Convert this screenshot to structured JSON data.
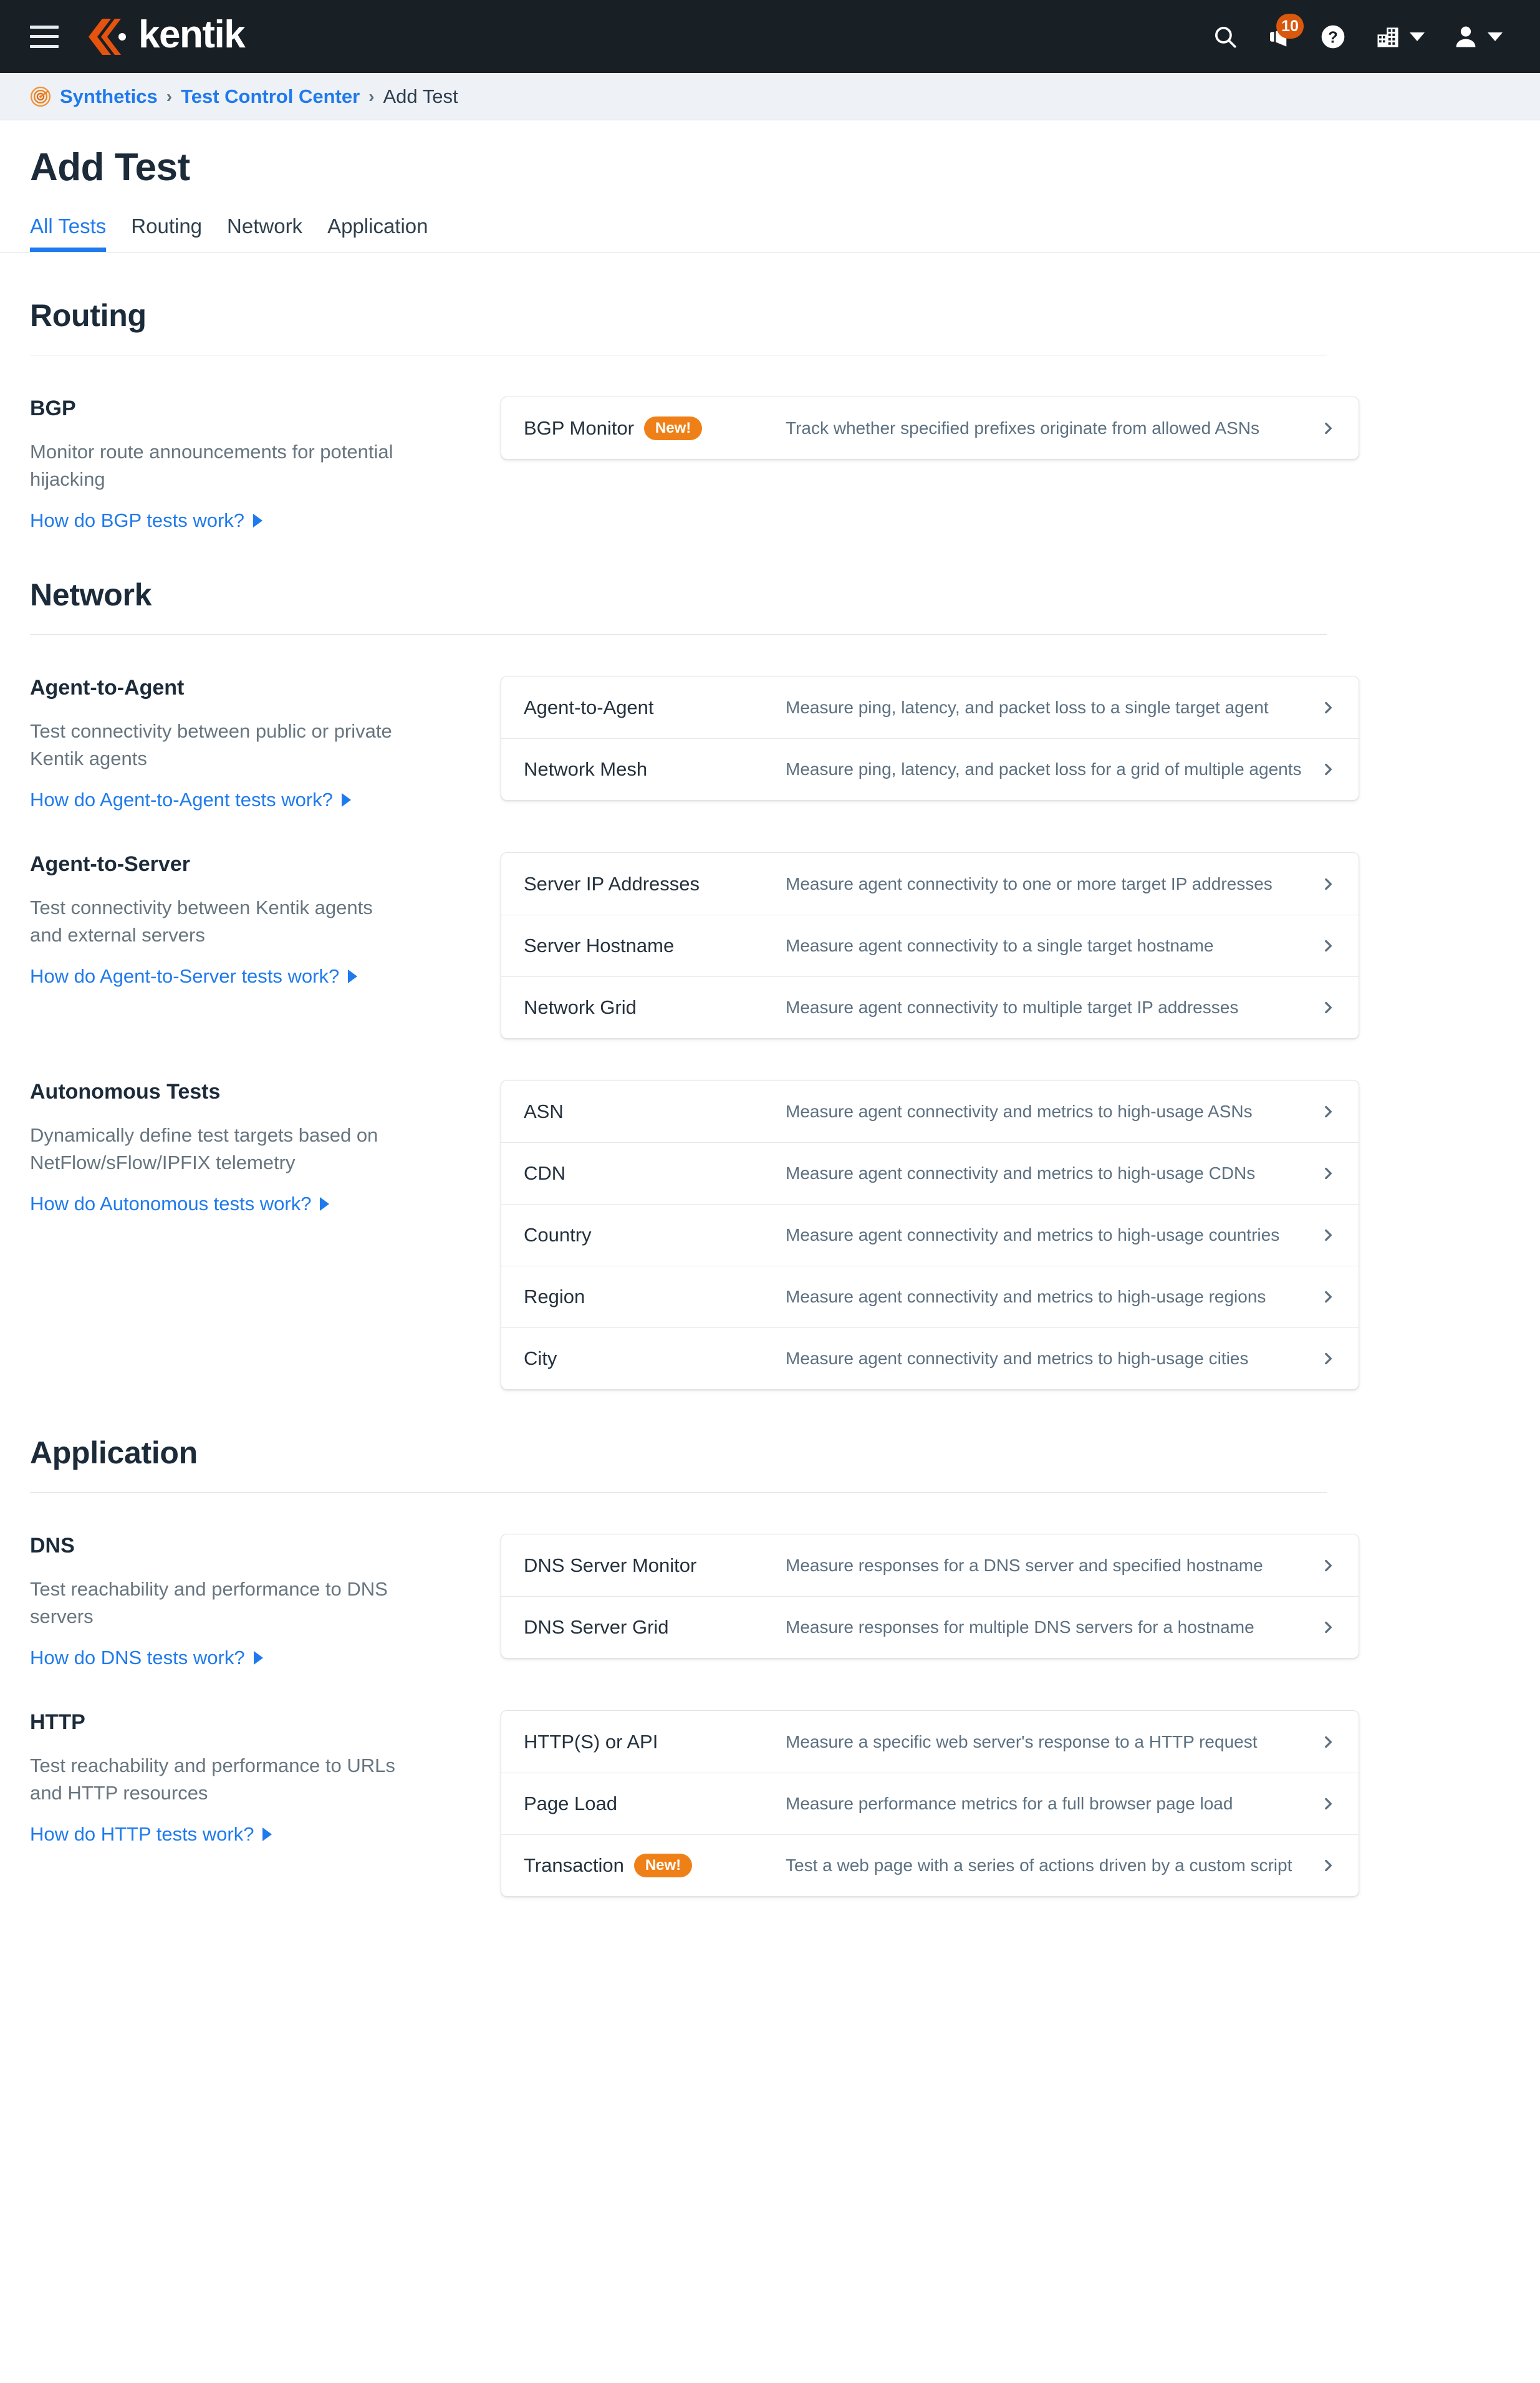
{
  "topnav": {
    "menu_icon": "hamburger-icon",
    "brand": "kentik",
    "search_icon": "search-icon",
    "announcements_icon": "announcement-icon",
    "announcements_badge": "10",
    "help_icon": "help-icon",
    "company_icon": "company-icon",
    "user_icon": "user-avatar-icon"
  },
  "breadcrumb": {
    "icon": "synthetics-radar-icon",
    "items": [
      "Synthetics",
      "Test Control Center"
    ],
    "separator": "›",
    "current": "Add Test"
  },
  "page": {
    "title": "Add Test",
    "tabs": [
      {
        "label": "All Tests",
        "active": true
      },
      {
        "label": "Routing",
        "active": false
      },
      {
        "label": "Network",
        "active": false
      },
      {
        "label": "Application",
        "active": false
      }
    ]
  },
  "colors": {
    "brand_orange": "#ef8018",
    "accent_blue": "#1f7aed",
    "nav_dark": "#182026",
    "badge_orange": "#d9580d"
  },
  "groups": [
    {
      "title": "Routing",
      "sections": [
        {
          "name": "BGP",
          "description": "Monitor route announcements for potential hijacking",
          "link": "How do BGP tests work?",
          "rows": [
            {
              "name": "BGP Monitor",
              "badge": "New!",
              "description": "Track whether specified prefixes originate from allowed ASNs"
            }
          ]
        }
      ]
    },
    {
      "title": "Network",
      "sections": [
        {
          "name": "Agent-to-Agent",
          "description": "Test connectivity between public or private Kentik agents",
          "link": "How do Agent-to-Agent tests work?",
          "rows": [
            {
              "name": "Agent-to-Agent",
              "badge": "",
              "description": "Measure ping, latency, and packet loss to a single target agent"
            },
            {
              "name": "Network Mesh",
              "badge": "",
              "description": "Measure ping, latency, and packet loss for a grid of multiple agents"
            }
          ]
        },
        {
          "name": "Agent-to-Server",
          "description": "Test connectivity between Kentik agents and external servers",
          "link": "How do Agent-to-Server tests work?",
          "rows": [
            {
              "name": "Server IP Addresses",
              "badge": "",
              "description": "Measure agent connectivity to one or more target IP addresses"
            },
            {
              "name": "Server Hostname",
              "badge": "",
              "description": "Measure agent connectivity to a single target hostname"
            },
            {
              "name": "Network Grid",
              "badge": "",
              "description": "Measure agent connectivity to multiple target IP addresses"
            }
          ]
        },
        {
          "name": "Autonomous Tests",
          "description": "Dynamically define test targets based on NetFlow/sFlow/IPFIX telemetry",
          "link": "How do Autonomous tests work?",
          "rows": [
            {
              "name": "ASN",
              "badge": "",
              "description": "Measure agent connectivity and metrics to high-usage ASNs"
            },
            {
              "name": "CDN",
              "badge": "",
              "description": "Measure agent connectivity and metrics to high-usage CDNs"
            },
            {
              "name": "Country",
              "badge": "",
              "description": "Measure agent connectivity and metrics to high-usage countries"
            },
            {
              "name": "Region",
              "badge": "",
              "description": "Measure agent connectivity and metrics to high-usage regions"
            },
            {
              "name": "City",
              "badge": "",
              "description": "Measure agent connectivity and metrics to high-usage cities"
            }
          ]
        }
      ]
    },
    {
      "title": "Application",
      "sections": [
        {
          "name": "DNS",
          "description": "Test reachability and performance to DNS servers",
          "link": "How do DNS tests work?",
          "rows": [
            {
              "name": "DNS Server Monitor",
              "badge": "",
              "description": "Measure responses for a DNS server and specified hostname"
            },
            {
              "name": "DNS Server Grid",
              "badge": "",
              "description": "Measure responses for multiple DNS servers for a hostname"
            }
          ]
        },
        {
          "name": "HTTP",
          "description": "Test reachability and performance to URLs and HTTP resources",
          "link": "How do HTTP tests work?",
          "rows": [
            {
              "name": "HTTP(S) or API",
              "badge": "",
              "description": "Measure a specific web server's response to a HTTP request"
            },
            {
              "name": "Page Load",
              "badge": "",
              "description": "Measure performance metrics for a full browser page load"
            },
            {
              "name": "Transaction",
              "badge": "New!",
              "description": "Test a web page with a series of actions driven by a custom script"
            }
          ]
        }
      ]
    }
  ]
}
